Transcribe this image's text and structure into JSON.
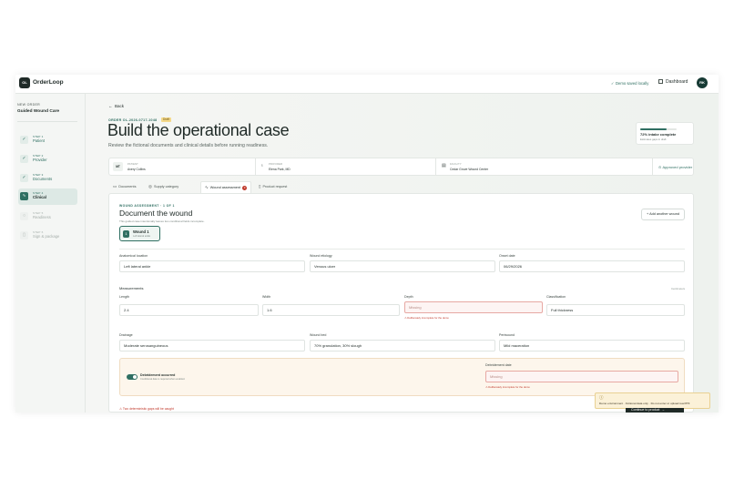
{
  "topbar": {
    "logo": "OL",
    "app_name": "OrderLoop",
    "saved_status": "Demo saved locally",
    "dashboard_label": "Dashboard",
    "avatar": "RK"
  },
  "sidebar": {
    "eyebrow": "NEW ORDER",
    "title": "Guided Wound Care",
    "steps": [
      {
        "num": "STEP 1",
        "label": "Patient",
        "state": "done"
      },
      {
        "num": "STEP 2",
        "label": "Provider",
        "state": "done"
      },
      {
        "num": "STEP 3",
        "label": "Documents",
        "state": "done"
      },
      {
        "num": "STEP 4",
        "label": "Clinical",
        "state": "active"
      },
      {
        "num": "STEP 5",
        "label": "Readiness",
        "state": "todo"
      },
      {
        "num": "STEP 6",
        "label": "Sign & package",
        "state": "todo"
      }
    ]
  },
  "header": {
    "back_label": "Back",
    "order_line": "ORDER OL-2026-0717-1048",
    "draft_badge": "Draft",
    "title": "Build the operational case",
    "subtitle": "Review the fictional documents and clinical details before running readiness.",
    "progress_fraction": 0.72,
    "progress_text": "72% intake complete",
    "progress_sub": "Estimates gaps in draft"
  },
  "summary": {
    "patient_key": "PATIENT",
    "patient_initials": "MT",
    "patient_value": "Avery Collins",
    "provider_key": "PROVIDER",
    "provider_value": "Elena Park, MD",
    "facility_key": "FACILITY",
    "facility_value": "Cedar Grove Wound Center",
    "approved_label": "Approved provider"
  },
  "tabs": [
    {
      "label": "Documents",
      "icon": "doc-icon"
    },
    {
      "label": "Supply category",
      "icon": "box-icon"
    },
    {
      "label": "Wound assessment",
      "icon": "pulse-icon",
      "count": "3"
    },
    {
      "label": "Product request",
      "icon": "clipboard-icon"
    }
  ],
  "card": {
    "eyebrow": "WOUND ASSESSMENT · 1 OF 1",
    "title": "Document the wound",
    "note": "This guided case intentionally leaves two conditional fields incomplete.",
    "wound_chip_num": "1",
    "wound_chip_title": "Wound 1",
    "wound_chip_sub": "Left lateral ankle",
    "add_wound_label": "+ Add another wound",
    "anatomical_label": "Anatomical location",
    "anatomical_value": "Left lateral ankle",
    "etiology_label": "Wound etiology",
    "etiology_value": "Venous ulcer",
    "onset_label": "Onset date",
    "onset_value": "06/29/2026",
    "measurements_title": "Measurements",
    "measurements_right": "Centimeters",
    "length_label": "Length",
    "length_value": "2.4",
    "width_label": "Width",
    "width_value": "1.6",
    "depth_label": "Depth",
    "depth_placeholder": "Missing",
    "depth_error": "Deliberately incomplete for the demo",
    "classification_label": "Classification",
    "classification_value": "Full thickness",
    "drainage_label": "Drainage",
    "drainage_value": "Moderate serosanguineous",
    "bed_label": "Wound bed",
    "bed_value": "70% granulation, 30% slough",
    "periwound_label": "Periwound",
    "periwound_value": "Mild maceration",
    "debridement_title": "Debridement occurred",
    "debridement_sub": "Conditional date is required when enabled.",
    "debridement_toggle_on": true,
    "debridement_date_label": "Debridement date",
    "debridement_date_placeholder": "Missing",
    "debridement_error": "Deliberately incomplete for the demo",
    "bottom_warning": "Two deterministic gaps will be caught"
  },
  "toast": {
    "text": "Demo environment · Fictional data only · Do not enter or upload real PHI"
  },
  "continue_label": "Continue to product"
}
